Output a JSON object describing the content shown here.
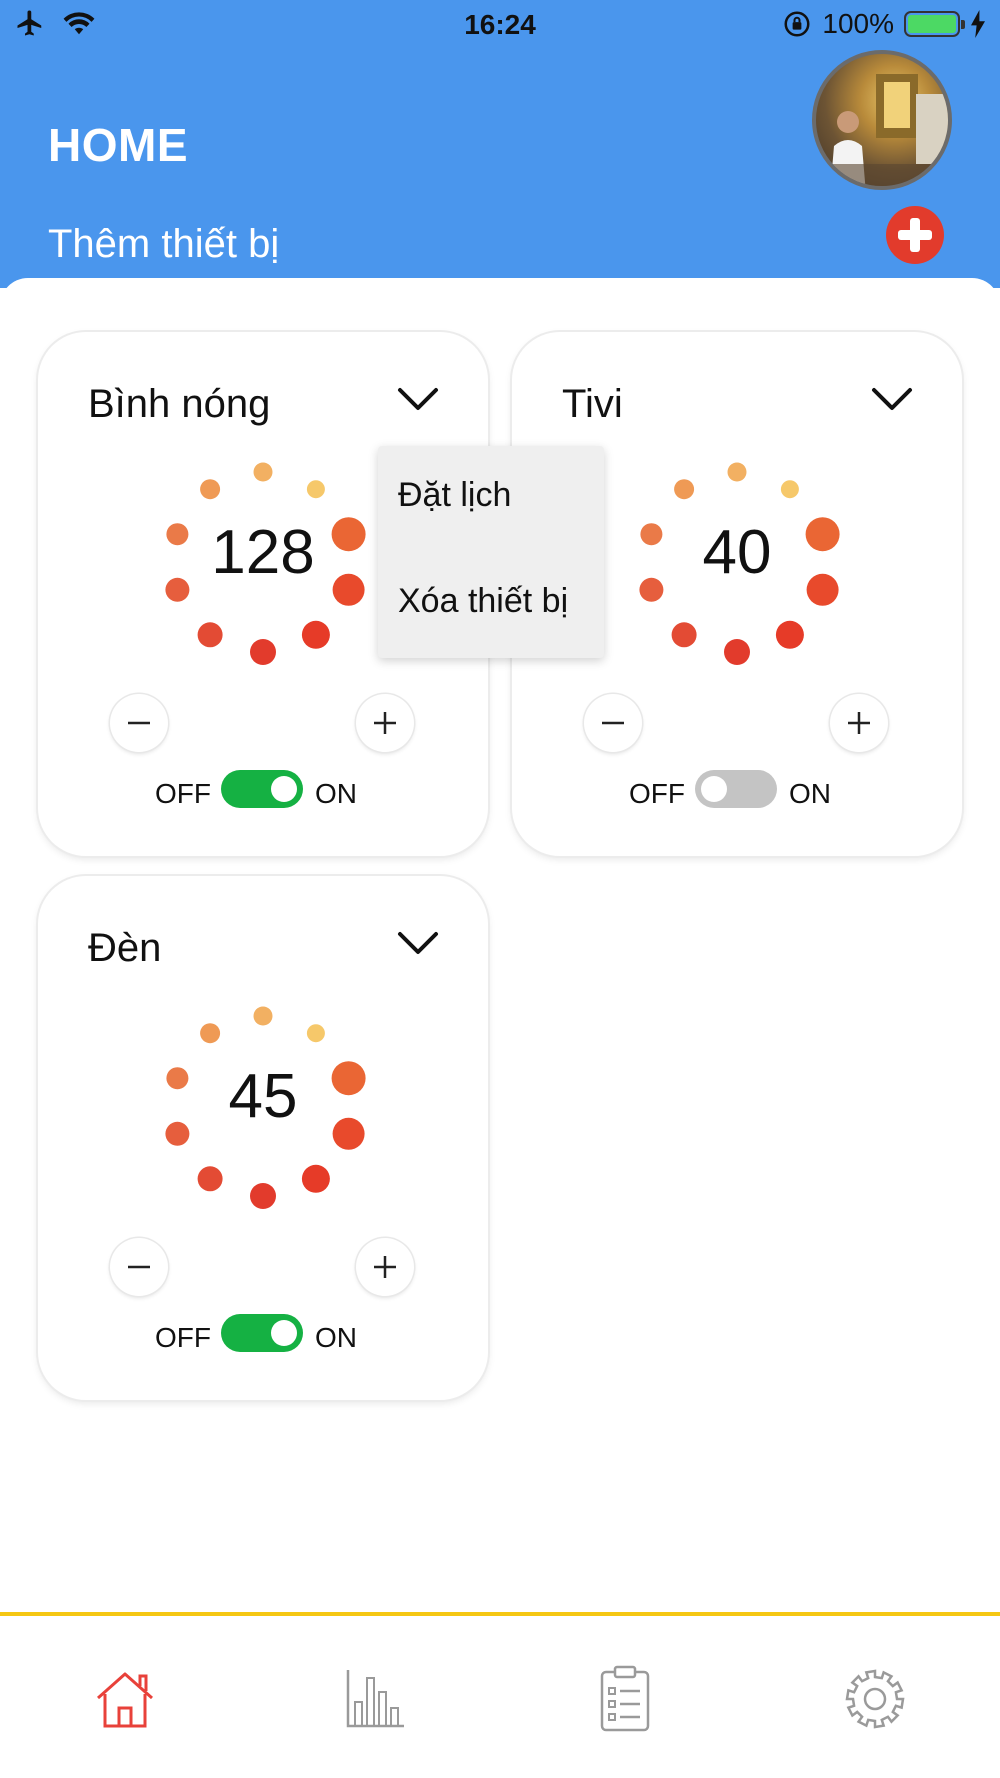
{
  "status_bar": {
    "time": "16:24",
    "battery": "100%",
    "icons": [
      "airplane-icon",
      "wifi-icon",
      "rotation-lock-icon",
      "battery-icon",
      "charging-icon"
    ]
  },
  "header": {
    "title": "HOME",
    "add_label": "Thêm thiết bị"
  },
  "devices": [
    {
      "name": "Bình nóng",
      "value": "128",
      "off_label": "OFF",
      "on_label": "ON",
      "state": "on"
    },
    {
      "name": "Tivi",
      "value": "40",
      "off_label": "OFF",
      "on_label": "ON",
      "state": "off"
    },
    {
      "name": "Đèn",
      "value": "45",
      "off_label": "OFF",
      "on_label": "ON",
      "state": "on"
    }
  ],
  "dropdown": {
    "items": [
      "Đặt lịch",
      "Xóa thiết bị"
    ]
  },
  "bottom_nav": {
    "items": [
      "home-icon",
      "stats-icon",
      "clipboard-icon",
      "settings-icon"
    ],
    "active": "home-icon"
  },
  "colors": {
    "header": "#4a96ed",
    "toggle_on": "#15b143",
    "toggle_off": "#c4c4c4",
    "accent_red": "#e23b2c",
    "nav_border": "#f5c712",
    "nav_active": "#e8413a",
    "nav_inactive": "#9a9a9a"
  }
}
